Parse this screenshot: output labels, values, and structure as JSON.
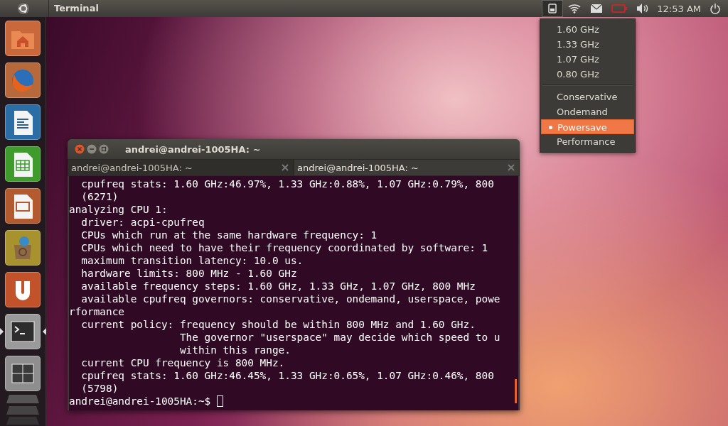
{
  "top_panel": {
    "app_title": "Terminal",
    "indicators": [
      {
        "kind": "cpufreq",
        "selected": true
      },
      {
        "kind": "wifi",
        "selected": false
      },
      {
        "kind": "mail",
        "selected": false
      },
      {
        "kind": "battery",
        "selected": false
      },
      {
        "kind": "volume",
        "selected": false
      }
    ],
    "clock": "12:53 AM"
  },
  "launcher": [
    {
      "kind": "files",
      "running": false,
      "focused": false
    },
    {
      "kind": "browser",
      "running": false,
      "focused": false
    },
    {
      "kind": "writer",
      "running": false,
      "focused": false
    },
    {
      "kind": "calc",
      "running": false,
      "focused": false
    },
    {
      "kind": "impress",
      "running": false,
      "focused": false
    },
    {
      "kind": "software",
      "running": false,
      "focused": false
    },
    {
      "kind": "ubuntu-one",
      "running": false,
      "focused": false
    },
    {
      "kind": "terminal",
      "running": true,
      "focused": true
    },
    {
      "kind": "workspaces",
      "running": false,
      "focused": false
    }
  ],
  "cpufreq_menu": {
    "frequencies": [
      "1.60 GHz",
      "1.33 GHz",
      "1.07 GHz",
      "0.80 GHz"
    ],
    "governors": [
      {
        "label": "Conservative",
        "selected": false
      },
      {
        "label": "Ondemand",
        "selected": false
      },
      {
        "label": "Powersave",
        "selected": true
      },
      {
        "label": "Performance",
        "selected": false
      }
    ]
  },
  "terminal": {
    "title": "andrei@andrei-1005HA: ~",
    "tabs": [
      {
        "label": "andrei@andrei-1005HA: ~",
        "selected": false
      },
      {
        "label": "andrei@andrei-1005HA: ~",
        "selected": true
      }
    ],
    "lines": [
      "  cpufreq stats: 1.60 GHz:46.97%, 1.33 GHz:0.88%, 1.07 GHz:0.79%, 800",
      "  (6271)",
      "analyzing CPU 1:",
      "  driver: acpi-cpufreq",
      "  CPUs which run at the same hardware frequency: 1",
      "  CPUs which need to have their frequency coordinated by software: 1",
      "  maximum transition latency: 10.0 us.",
      "  hardware limits: 800 MHz - 1.60 GHz",
      "  available frequency steps: 1.60 GHz, 1.33 GHz, 1.07 GHz, 800 MHz",
      "  available cpufreq governors: conservative, ondemand, userspace, powe",
      "rformance",
      "  current policy: frequency should be within 800 MHz and 1.60 GHz.",
      "                  The governor \"userspace\" may decide which speed to u",
      "                  within this range.",
      "  current CPU frequency is 800 MHz.",
      "  cpufreq stats: 1.60 GHz:46.45%, 1.33 GHz:0.65%, 1.07 GHz:0.46%, 800",
      "  (5798)"
    ],
    "prompt": "andrei@andrei-1005HA:~$"
  }
}
